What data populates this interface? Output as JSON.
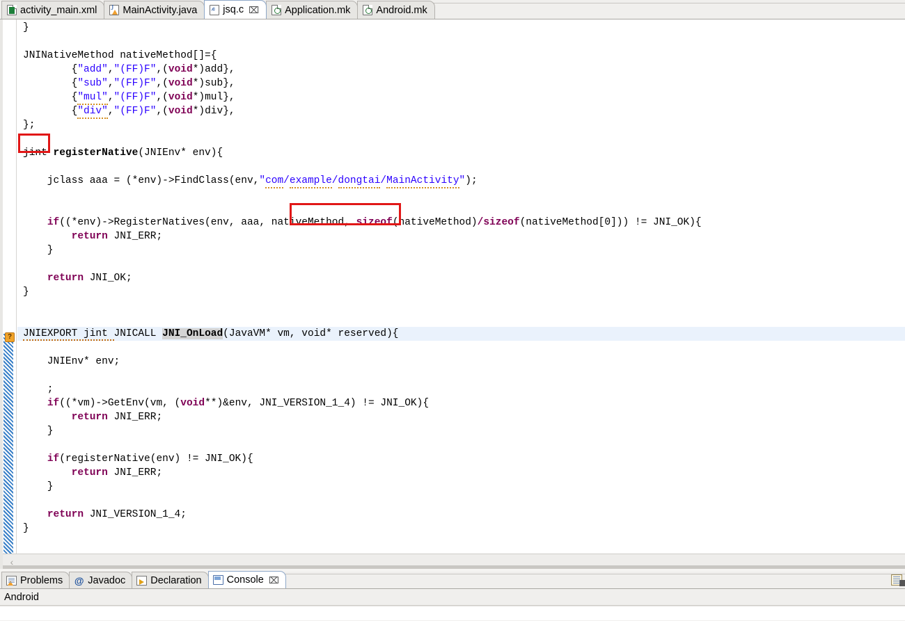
{
  "window": {
    "app": "Eclipse IDE",
    "accent_color": "#2a00ff",
    "keyword_color": "#7f0055",
    "annotation_box_color": "#e11717",
    "highlight_line_color": "#eaf2fc"
  },
  "editor_tabs": [
    {
      "label": "activity_main.xml",
      "icon": "xml-file-icon",
      "active": false,
      "closable": false
    },
    {
      "label": "MainActivity.java",
      "icon": "java-file-warning-icon",
      "active": false,
      "closable": false
    },
    {
      "label": "jsq.c",
      "icon": "c-file-icon",
      "active": true,
      "closable": true,
      "close_glyph": "⌧"
    },
    {
      "label": "Application.mk",
      "icon": "makefile-icon",
      "active": false,
      "closable": false
    },
    {
      "label": "Android.mk",
      "icon": "makefile-icon",
      "active": false,
      "closable": false
    }
  ],
  "gutter": {
    "warning_marker_glyph": "?",
    "warning_marker_tooltip": "?"
  },
  "code_lines": [
    {
      "n": 1,
      "html": "}"
    },
    {
      "n": 2,
      "html": ""
    },
    {
      "n": 3,
      "html": "JNINativeMethod nativeMethod[]={"
    },
    {
      "n": 4,
      "html": "        {<span class=\"str\">\"add\"</span>,<span class=\"str\">\"(FF)F\"</span>,(<span class=\"kw\">void</span>*)add},"
    },
    {
      "n": 5,
      "html": "        {<span class=\"str\">\"sub\"</span>,<span class=\"str\">\"(FF)F\"</span>,(<span class=\"kw\">void</span>*)sub},"
    },
    {
      "n": 6,
      "html": "        {<span class=\"str sq\">\"mul\"</span>,<span class=\"str\">\"(FF)F\"</span>,(<span class=\"kw\">void</span>*)mul},"
    },
    {
      "n": 7,
      "html": "        {<span class=\"str sq\">\"div\"</span>,<span class=\"str\">\"(FF)F\"</span>,(<span class=\"kw\">void</span>*)div},"
    },
    {
      "n": 8,
      "html": "};"
    },
    {
      "n": 9,
      "html": ""
    },
    {
      "n": 10,
      "html": "jint <span class=\"fn\">registerNative</span>(JNIEnv* env){"
    },
    {
      "n": 11,
      "html": ""
    },
    {
      "n": 12,
      "html": "    jclass aaa = (*env)-&gt;FindClass(env,<span class=\"str\">\"<span class=\"sq\">com</span>/<span class=\"sq\">example</span>/<span class=\"sq\">dongtai</span>/<span class=\"sq\">MainActivity</span>\"</span>);"
    },
    {
      "n": 13,
      "html": ""
    },
    {
      "n": 14,
      "html": ""
    },
    {
      "n": 15,
      "html": "    <span class=\"kw\">if</span>((*env)-&gt;RegisterNatives(env, aaa, nativeMethod, <span class=\"kw\">sizeof</span>(nativeMethod)<span class=\"kw\">/</span><span class=\"kw\">sizeof</span>(nativeMethod[0])) != JNI_OK){"
    },
    {
      "n": 16,
      "html": "        <span class=\"kw\">return</span> JNI_ERR;"
    },
    {
      "n": 17,
      "html": "    }"
    },
    {
      "n": 18,
      "html": ""
    },
    {
      "n": 19,
      "html": "    <span class=\"kw\">return</span> JNI_OK;"
    },
    {
      "n": 20,
      "html": "}"
    },
    {
      "n": 21,
      "html": ""
    },
    {
      "n": 22,
      "html": ""
    },
    {
      "n": 23,
      "html": "",
      "highlight": true,
      "content": "JNIEXPORT jint JNICALL JNI_OnLoad(JavaVM* vm, void* reserved){"
    },
    {
      "n": 24,
      "html": ""
    },
    {
      "n": 25,
      "html": "    JNIEnv* env;"
    },
    {
      "n": 26,
      "html": ""
    },
    {
      "n": 27,
      "html": "    ;"
    },
    {
      "n": 28,
      "html": "    <span class=\"kw\">if</span>((*vm)-&gt;GetEnv(vm, (<span class=\"kw\">void</span>**)&amp;env, JNI_VERSION_1_4) != JNI_OK){"
    },
    {
      "n": 29,
      "html": "        <span class=\"kw\">return</span> JNI_ERR;"
    },
    {
      "n": 30,
      "html": "    }"
    },
    {
      "n": 31,
      "html": ""
    },
    {
      "n": 32,
      "html": "    <span class=\"kw\">if</span>(registerNative(env) != JNI_OK){"
    },
    {
      "n": 33,
      "html": "        <span class=\"kw\">return</span> JNI_ERR;"
    },
    {
      "n": 34,
      "html": "    }"
    },
    {
      "n": 35,
      "html": ""
    },
    {
      "n": 36,
      "html": "    <span class=\"kw\">return</span> JNI_VERSION_1_4;"
    },
    {
      "n": 37,
      "html": "}"
    }
  ],
  "highlighted_signature": {
    "export": "JNIEXPORT",
    "return_type": "jint",
    "calling_convention": "JNICALL",
    "name": "JNI_OnLoad",
    "params": "(JavaVM* vm, void* reserved){"
  },
  "annotations": [
    {
      "label": "jint-return-type-box",
      "target_text": "jint"
    },
    {
      "label": "nativeMethod-argument-box",
      "target_text": ", nativeMethod,"
    }
  ],
  "scrollbar": {
    "left_arrow_glyph": "‹"
  },
  "bottom_tabs": [
    {
      "label": "Problems",
      "icon": "problems-icon",
      "active": false,
      "closable": false
    },
    {
      "label": "Javadoc",
      "icon": "javadoc-icon",
      "active": false,
      "closable": false,
      "glyph": "@"
    },
    {
      "label": "Declaration",
      "icon": "declaration-icon",
      "active": false,
      "closable": false
    },
    {
      "label": "Console",
      "icon": "console-icon",
      "active": true,
      "closable": true,
      "close_glyph": "⌧"
    }
  ],
  "console": {
    "title": "Android",
    "toolbar_icon": "display-selected-console-icon",
    "output": ""
  }
}
